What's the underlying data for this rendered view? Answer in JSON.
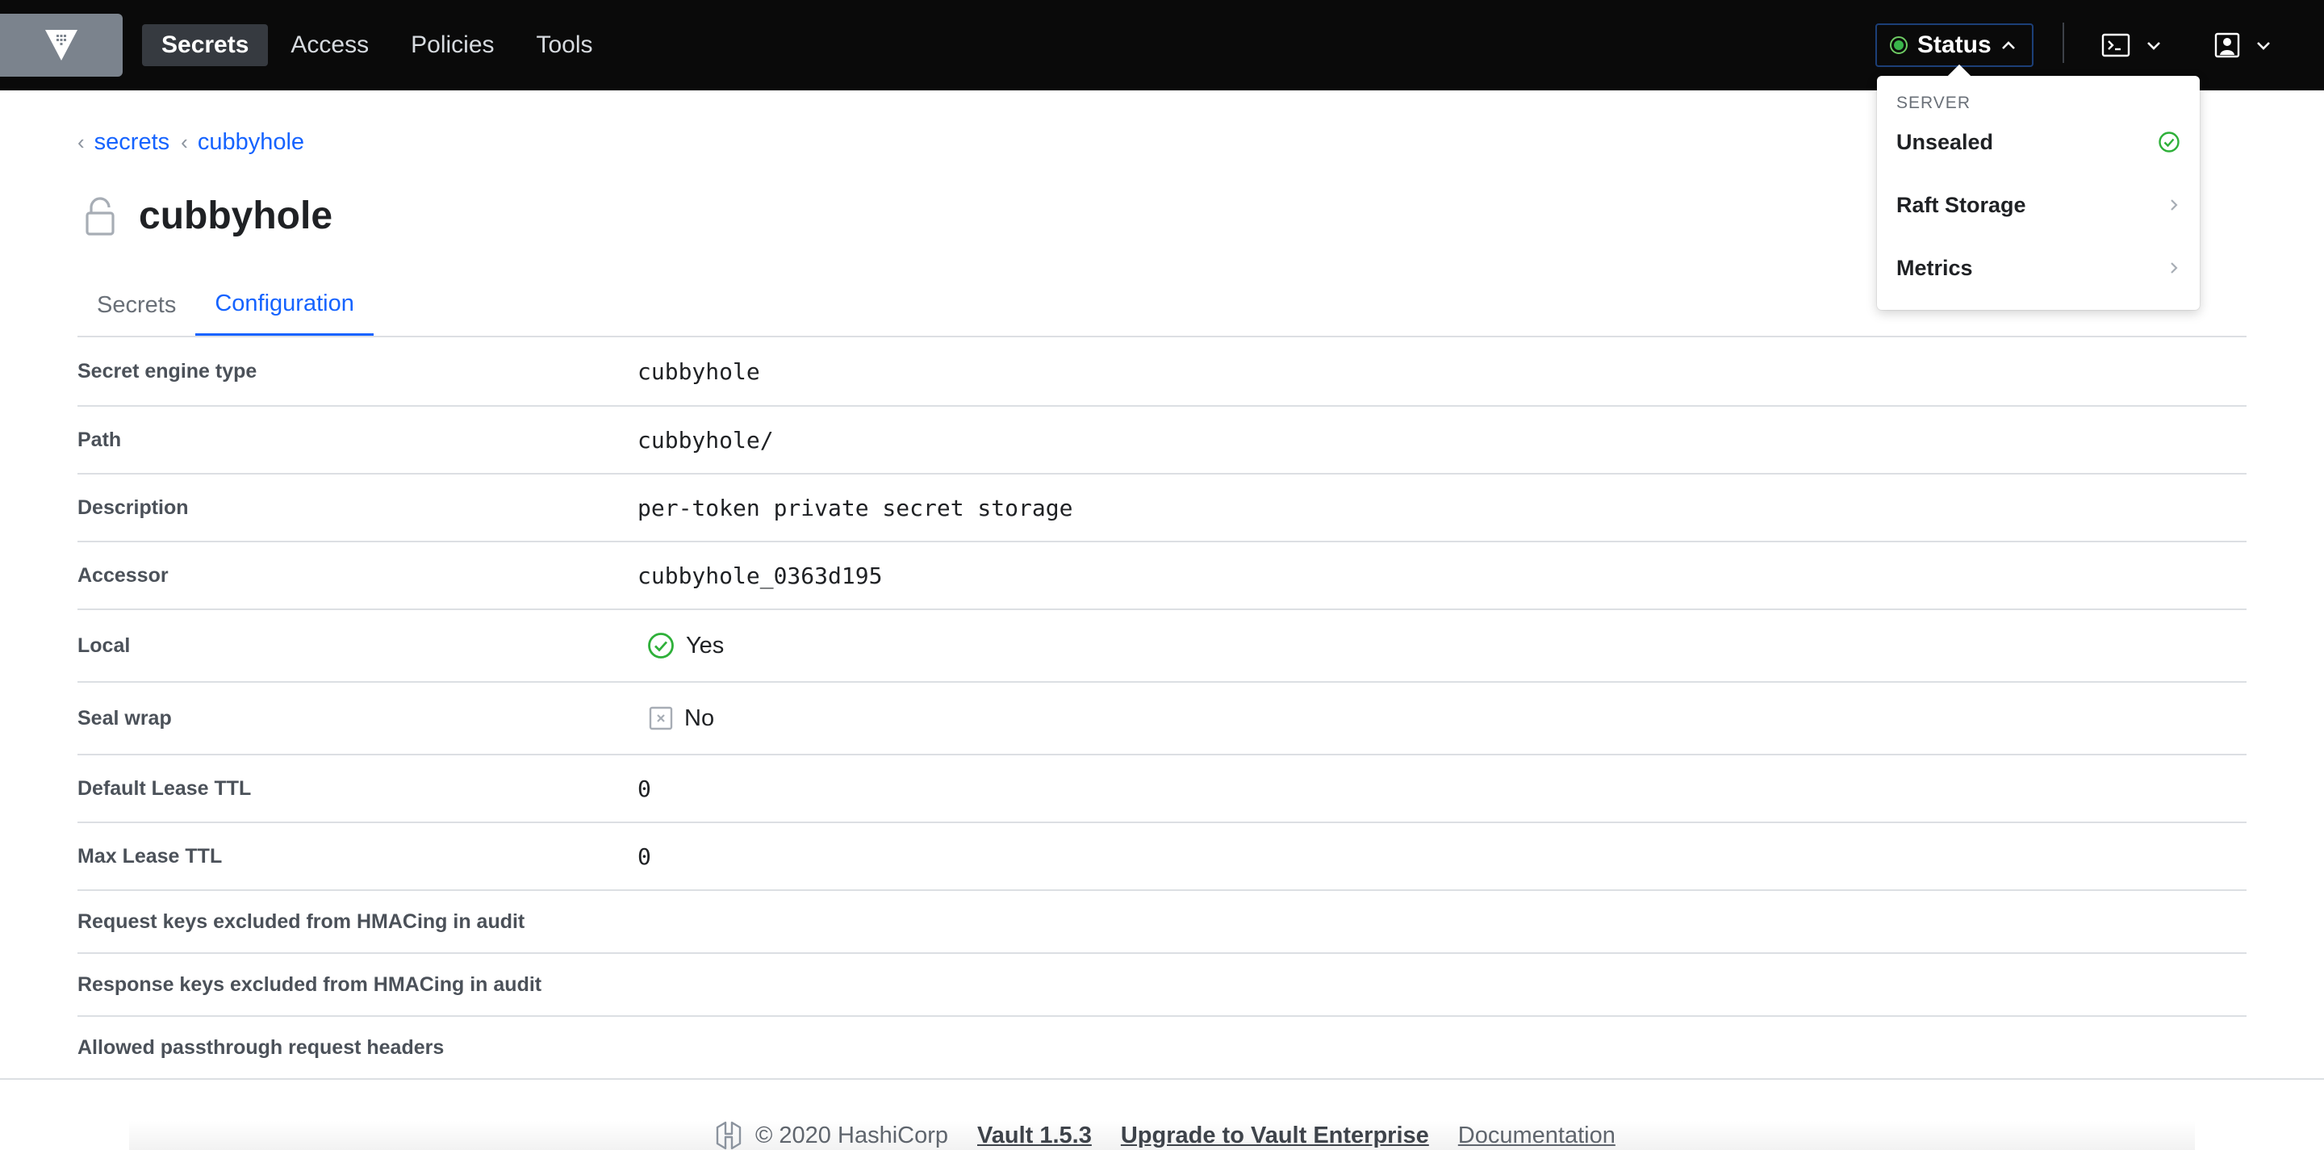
{
  "nav": {
    "items": [
      {
        "label": "Secrets"
      },
      {
        "label": "Access"
      },
      {
        "label": "Policies"
      },
      {
        "label": "Tools"
      }
    ],
    "status_label": "Status"
  },
  "breadcrumb": [
    {
      "label": "secrets"
    },
    {
      "label": "cubbyhole"
    }
  ],
  "page": {
    "title": "cubbyhole",
    "tabs": [
      {
        "label": "Secrets"
      },
      {
        "label": "Configuration"
      }
    ]
  },
  "config": {
    "rows": [
      {
        "label": "Secret engine type",
        "value": "cubbyhole"
      },
      {
        "label": "Path",
        "value": "cubbyhole/"
      },
      {
        "label": "Description",
        "value": "per-token private secret storage"
      },
      {
        "label": "Accessor",
        "value": "cubbyhole_0363d195"
      },
      {
        "label": "Local",
        "value": "Yes"
      },
      {
        "label": "Seal wrap",
        "value": "No"
      },
      {
        "label": "Default Lease TTL",
        "value": "0"
      },
      {
        "label": "Max Lease TTL",
        "value": "0"
      },
      {
        "label": "Request keys excluded from HMACing in audit",
        "value": ""
      },
      {
        "label": "Response keys excluded from HMACing in audit",
        "value": ""
      },
      {
        "label": "Allowed passthrough request headers",
        "value": ""
      }
    ]
  },
  "status_menu": {
    "heading": "SERVER",
    "items": [
      {
        "label": "Unsealed",
        "icon": "check-circle-icon"
      },
      {
        "label": "Raft Storage",
        "icon": "chevron-right-icon"
      },
      {
        "label": "Metrics",
        "icon": "chevron-right-icon"
      }
    ]
  },
  "footer": {
    "copyright": "© 2020 HashiCorp",
    "version": "Vault 1.5.3",
    "upgrade": "Upgrade to Vault Enterprise",
    "docs": "Documentation"
  },
  "colors": {
    "accent": "#1563ff",
    "nav_bg": "#0a0a0a",
    "success": "#39b54a"
  }
}
